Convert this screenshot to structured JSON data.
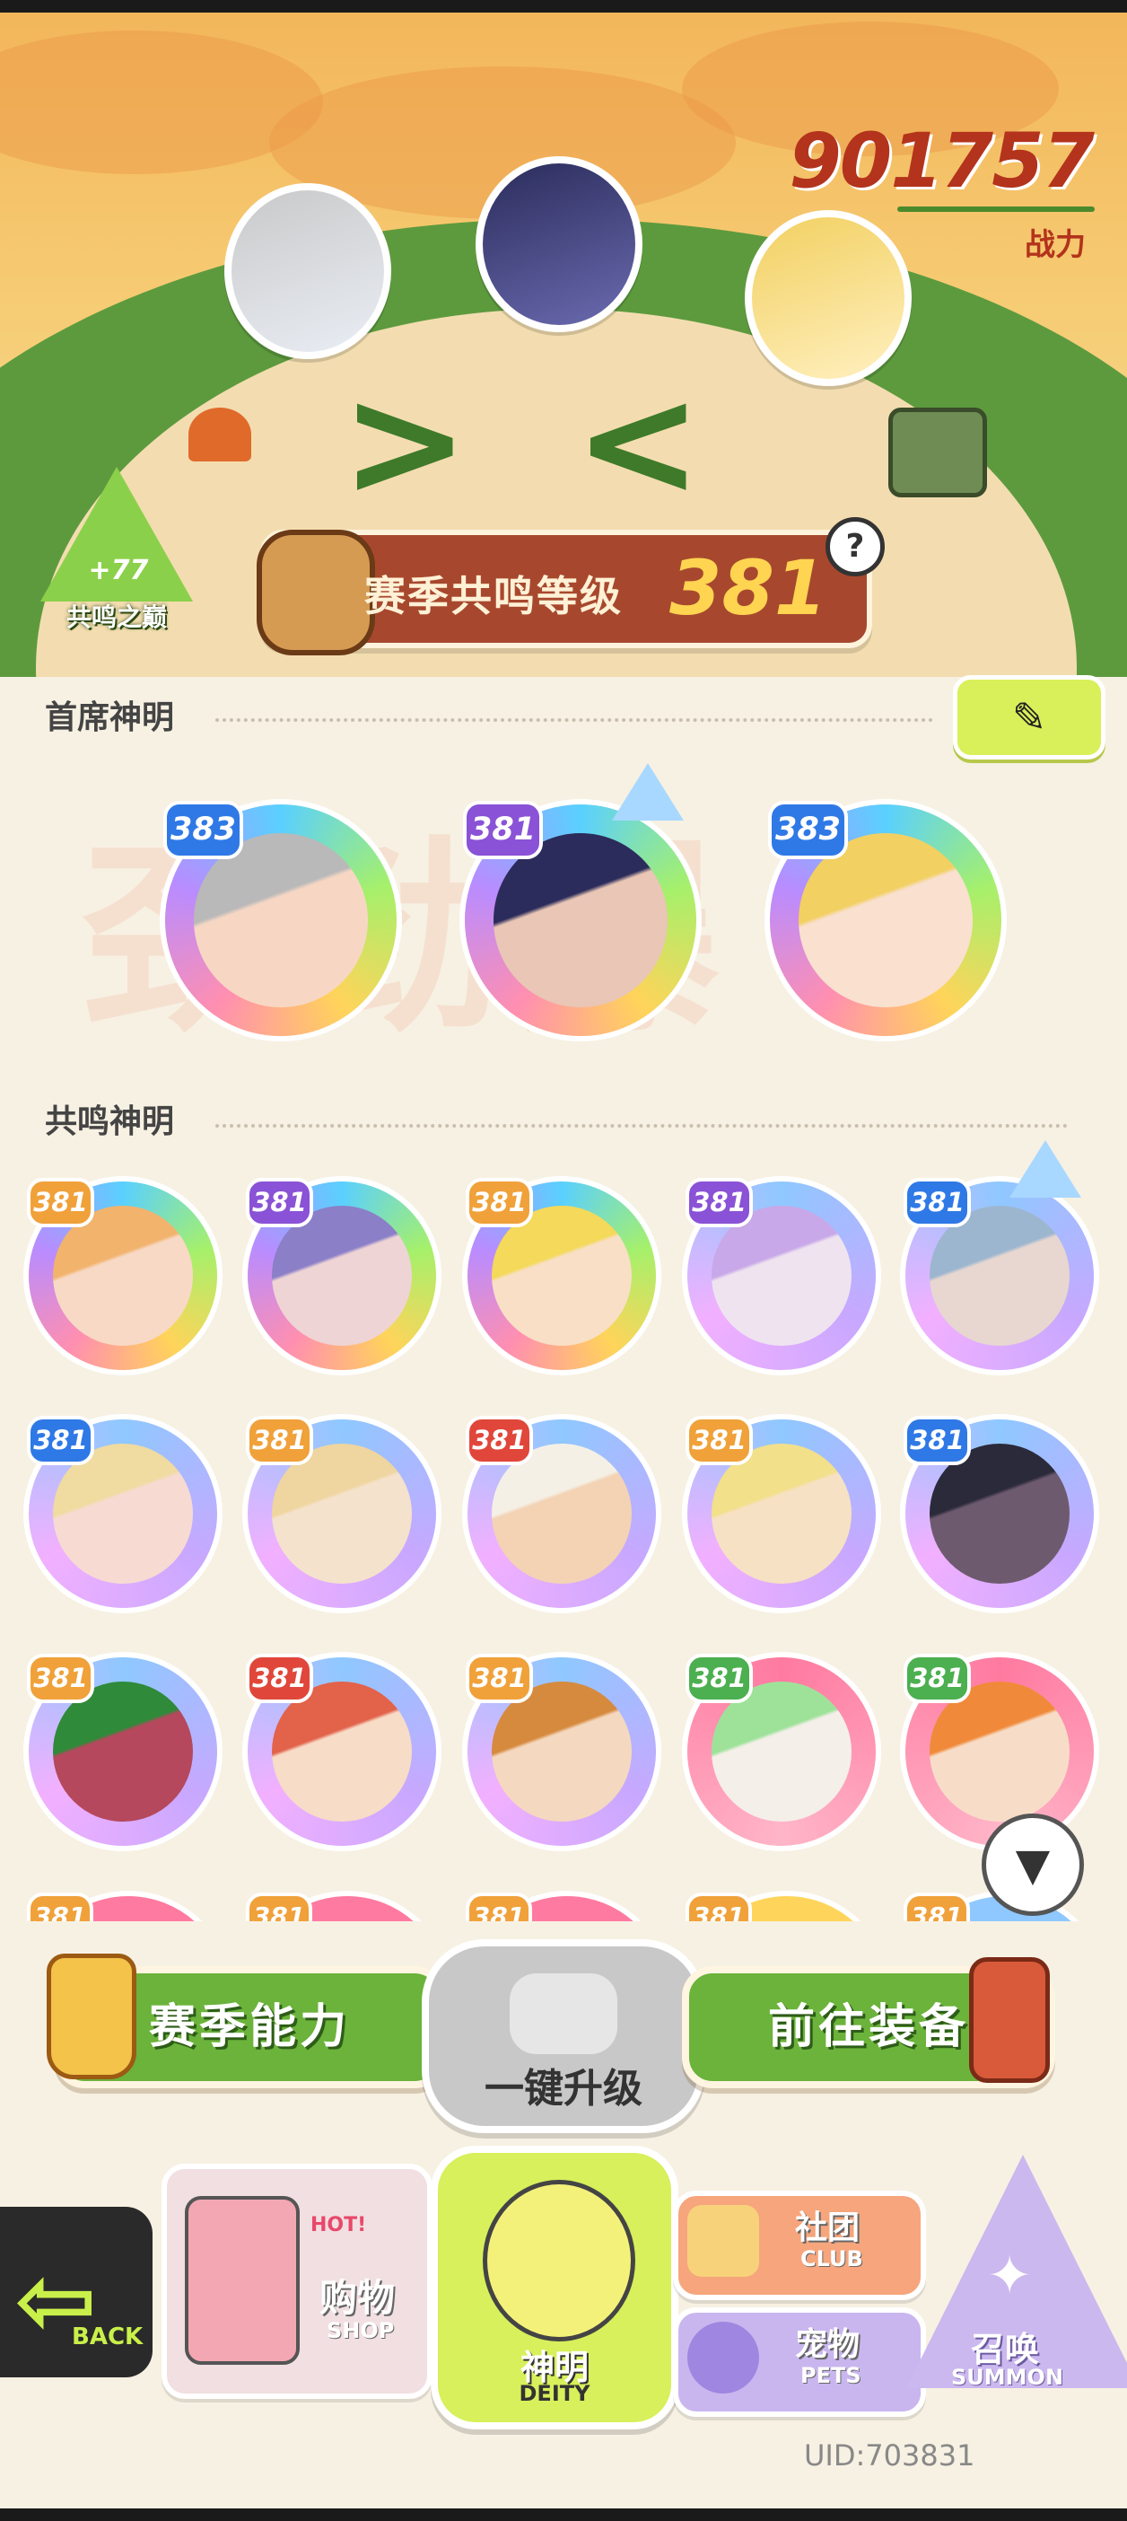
{
  "header": {
    "power_value": "901757",
    "power_label": "战力",
    "peak_value": "+77",
    "peak_label": "共鸣之巅",
    "season_level_label": "赛季共鸣等级",
    "season_level_value": "381",
    "help_symbol": "?"
  },
  "sections": {
    "chief_title": "首席神明",
    "resonance_title": "共鸣神明",
    "edit_symbol": "✎"
  },
  "watermark": "劲劲爆",
  "chief_deities": [
    {
      "level": "383",
      "ring": "rainbow",
      "skin": "#f7d7c4",
      "hair": "#b9b9b9",
      "lvl_color": "#2f79e6"
    },
    {
      "level": "381",
      "ring": "rainbow",
      "skin": "#e9c6b5",
      "hair": "#2b2c5b",
      "lvl_color": "#8a52d6",
      "crown": true
    },
    {
      "level": "383",
      "ring": "rainbow",
      "skin": "#f9e0cf",
      "hair": "#f2d061",
      "lvl_color": "#2f79e6"
    }
  ],
  "resonance_deities": [
    {
      "level": "381",
      "ring": "rainbow",
      "skin": "#f7d9c5",
      "hair": "#f2b36d",
      "lvl_color": "#f0a13a"
    },
    {
      "level": "381",
      "ring": "rainbow",
      "skin": "#efd4d5",
      "hair": "#8b7fc8",
      "lvl_color": "#8a52d6"
    },
    {
      "level": "381",
      "ring": "rainbow",
      "skin": "#f8dfc6",
      "hair": "#f4d95a",
      "lvl_color": "#f0a13a"
    },
    {
      "level": "381",
      "ring": "purple",
      "skin": "#efe3f0",
      "hair": "#c8a8e8",
      "lvl_color": "#8a52d6"
    },
    {
      "level": "381",
      "ring": "purple",
      "skin": "#e7d7d0",
      "hair": "#9db6d0",
      "lvl_color": "#2f79e6",
      "crown": true
    },
    {
      "level": "381",
      "ring": "purple",
      "skin": "#f7dbd3",
      "hair": "#f0dba0",
      "lvl_color": "#2f79e6"
    },
    {
      "level": "381",
      "ring": "purple",
      "skin": "#f5e2cc",
      "hair": "#efd59f",
      "lvl_color": "#f0a13a"
    },
    {
      "level": "381",
      "ring": "purple",
      "skin": "#f3d3b4",
      "hair": "#f5f0e6",
      "lvl_color": "#e0473a"
    },
    {
      "level": "381",
      "ring": "purple",
      "skin": "#f6e1c4",
      "hair": "#f2e08a",
      "lvl_color": "#f0a13a"
    },
    {
      "level": "381",
      "ring": "purple",
      "skin": "#6e5a6e",
      "hair": "#2a2a3a",
      "lvl_color": "#2f79e6"
    },
    {
      "level": "381",
      "ring": "purple",
      "skin": "#b5485c",
      "hair": "#2f8a3a",
      "lvl_color": "#f0a13a"
    },
    {
      "level": "381",
      "ring": "purple",
      "skin": "#f7dcc7",
      "hair": "#e2624a",
      "lvl_color": "#e0473a"
    },
    {
      "level": "381",
      "ring": "purple",
      "skin": "#f4d8c0",
      "hair": "#d68a3e",
      "lvl_color": "#f0a13a"
    },
    {
      "level": "381",
      "ring": "pink",
      "skin": "#f4efe9",
      "hair": "#9ee29a",
      "lvl_color": "#4caf50"
    },
    {
      "level": "381",
      "ring": "pink",
      "skin": "#f7ddc8",
      "hair": "#f08a3a",
      "lvl_color": "#4caf50"
    }
  ],
  "cut_row_levels": [
    "381",
    "381",
    "381",
    "381",
    "381"
  ],
  "actions": {
    "season_ability": "赛季能力",
    "one_key_upgrade": "一键升级",
    "goto_equipment": "前往装备"
  },
  "nav": {
    "back_label": "BACK",
    "shop_hot": "HOT!",
    "shop_cn": "购物",
    "shop_en": "SHOP",
    "club_cn": "社团",
    "club_en": "CLUB",
    "pets_cn": "宠物",
    "pets_en": "PETS",
    "deity_cn": "神明",
    "deity_en": "DEITY",
    "summon_cn": "召唤",
    "summon_en": "SUMMON"
  },
  "uid": "UID:703831",
  "colors": {
    "accent_red": "#b3331c",
    "green_button": "#6bb33b",
    "lime": "#d7f05b",
    "background": "#f7f1e3"
  }
}
